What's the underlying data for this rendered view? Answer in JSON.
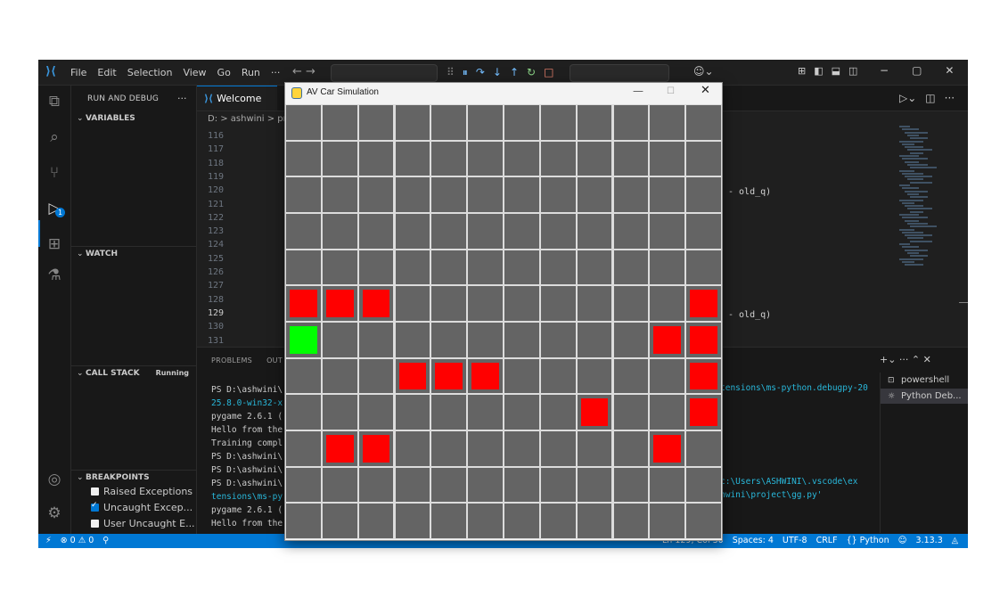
{
  "titlebar": {
    "logo": "⟩⟨",
    "menu": [
      "File",
      "Edit",
      "Selection",
      "View",
      "Go",
      "Run",
      "···"
    ],
    "nav": "←  →",
    "debug_toolbar": {
      "grip": "⠿",
      "pause": "⏸",
      "step_over": "↷",
      "step_into": "↓",
      "step_out": "↑",
      "restart": "↻",
      "stop": "□"
    },
    "account_icon": "copilot-icon",
    "window_controls": [
      "−",
      "▢",
      "✕"
    ]
  },
  "activity_icons": [
    "explorer-icon",
    "search-icon",
    "source-control-icon",
    "run-debug-icon",
    "extensions-icon",
    "testing-icon",
    "accounts-icon",
    "settings-icon"
  ],
  "activity_badge": "1",
  "sidebar": {
    "title": "RUN AND DEBUG",
    "more": "···",
    "sections": {
      "variables": "VARIABLES",
      "watch": "WATCH",
      "call_stack": "CALL STACK",
      "call_stack_status": "Running",
      "breakpoints": "BREAKPOINTS"
    },
    "breakpoints": [
      {
        "label": "Raised Exceptions",
        "checked": false
      },
      {
        "label": "Uncaught Excep...",
        "checked": true
      },
      {
        "label": "User Uncaught E...",
        "checked": false
      }
    ]
  },
  "editor": {
    "tab": "Welcome",
    "breadcrumb": "D: > ashwini > pro",
    "line_numbers": [
      "116",
      "117",
      "118",
      "119",
      "120",
      "121",
      "122",
      "123",
      "124",
      "125",
      "126",
      "127",
      "128",
      "129",
      "130",
      "131"
    ],
    "current_line": "129",
    "code_fragments": [
      {
        "line": "118",
        "text": "- old_q)"
      },
      {
        "line": "127",
        "text": "- old_q)"
      }
    ]
  },
  "panel": {
    "tabs": [
      "PROBLEMS",
      "OUT"
    ],
    "terminal_left": [
      {
        "text": "PS D:\\ashwini\\",
        "cyan": false
      },
      {
        "text": "25.8.0-win32-x",
        "cyan": true
      },
      {
        "text": "pygame 2.6.1 (",
        "cyan": false
      },
      {
        "text": "Hello from the",
        "cyan": false
      },
      {
        "text": "Training compl",
        "cyan": false
      },
      {
        "text": "PS D:\\ashwini\\",
        "cyan": false
      },
      {
        "text": "PS D:\\ashwini\\",
        "cyan": false
      },
      {
        "text": "PS D:\\ashwini\\",
        "cyan": false
      },
      {
        "text": "tensions\\ms-py",
        "cyan": true
      },
      {
        "text": "pygame 2.6.1 (",
        "cyan": false
      },
      {
        "text": "Hello from the",
        "cyan": false
      },
      {
        "text": "▯",
        "cyan": false
      }
    ],
    "terminal_right": [
      {
        "row": 0,
        "text": "tensions\\ms-python.debugpy-20",
        "cyan": true
      },
      {
        "row": 7,
        "text": "c:\\Users\\ASHWINI\\.vscode\\ex",
        "cyan": true
      },
      {
        "row": 8,
        "text": "hwini\\project\\gg.py'",
        "cyan": true
      }
    ],
    "actions": "+⌄  ···  ⌃  ✕",
    "terminals": [
      {
        "label": "powershell",
        "selected": false
      },
      {
        "label": "Python Deb...",
        "selected": true
      }
    ]
  },
  "statusbar": {
    "left": [
      "⚡",
      "⊗ 0 ⚠ 0",
      "⚲"
    ],
    "right": [
      "Ln 129, Col 30",
      "Spaces: 4",
      "UTF-8",
      "CRLF",
      "{} Python",
      "3.13.3"
    ]
  },
  "pygame_window": {
    "title": "AV Car Simulation",
    "controls": [
      "—",
      "☐",
      "✕"
    ],
    "grid": {
      "cols": 12,
      "rows": 12,
      "empty_color": "#646464",
      "obstacle_color": "#ff0000",
      "agent_color": "#00ff00",
      "obstacles": [
        [
          5,
          0
        ],
        [
          5,
          1
        ],
        [
          5,
          2
        ],
        [
          5,
          11
        ],
        [
          6,
          10
        ],
        [
          6,
          11
        ],
        [
          7,
          3
        ],
        [
          7,
          4
        ],
        [
          7,
          5
        ],
        [
          7,
          11
        ],
        [
          8,
          8
        ],
        [
          8,
          11
        ],
        [
          9,
          1
        ],
        [
          9,
          2
        ],
        [
          9,
          10
        ]
      ],
      "agent": [
        6,
        0
      ]
    }
  }
}
